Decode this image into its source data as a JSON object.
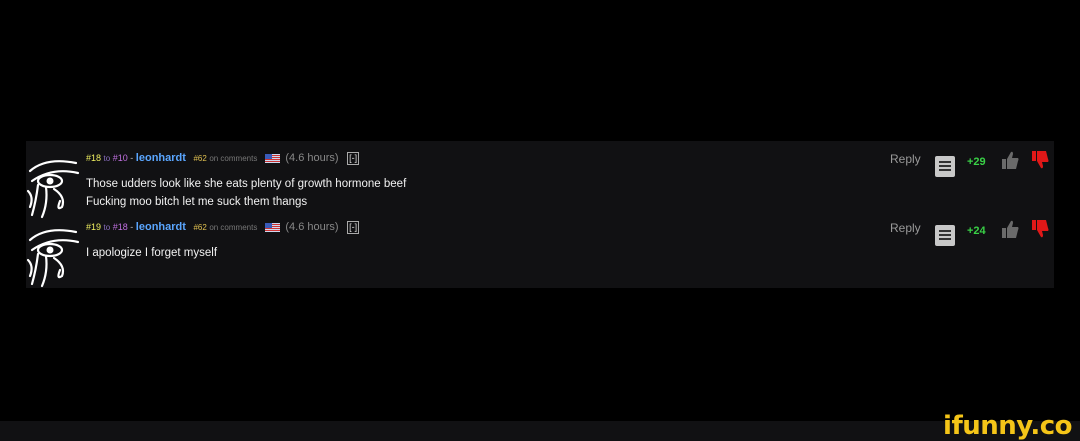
{
  "comments": [
    {
      "num": "#18",
      "to_label": "to",
      "to_num": "#10",
      "separator": "-",
      "username": "leonhardt",
      "rank": "#62",
      "on_comments": "on comments",
      "time": "(4.6 hours)",
      "collapse": "[-]",
      "lines": [
        "Those udders look like she eats plenty of growth hormone beef",
        "Fucking moo bitch let me suck them thangs"
      ],
      "reply": "Reply",
      "score": "+29"
    },
    {
      "num": "#19",
      "to_label": "to",
      "to_num": "#18",
      "separator": "-",
      "username": "leonhardt",
      "rank": "#62",
      "on_comments": "on comments",
      "time": "(4.6 hours)",
      "collapse": "[-]",
      "lines": [
        "I apologize I forget myself"
      ],
      "reply": "Reply",
      "score": "+24"
    }
  ],
  "colors": {
    "score": "#39d046",
    "username": "#5aa6ff",
    "thumb_down": "#e01818",
    "brand": "#f5c518"
  },
  "watermark": "ifunny.co"
}
